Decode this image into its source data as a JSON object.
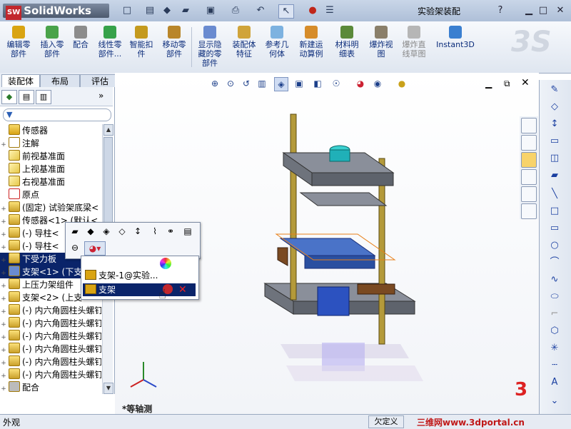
{
  "titlebar": {
    "app_name": "SolidWorks",
    "logo_badge": "SW",
    "window_title": "实验架装配",
    "help": "?",
    "quick_access": [
      "new-icon",
      "properties-icon",
      "rebuild-icon",
      "open-icon",
      "save-icon",
      "print-icon",
      "undo-icon",
      "select-icon",
      "traffic-light-icon",
      "options-icon"
    ]
  },
  "commands": [
    {
      "label": "编辑零\n部件"
    },
    {
      "label": "插入零\n部件"
    },
    {
      "label": "配合"
    },
    {
      "label": "线性零\n部件..."
    },
    {
      "label": "智能扣\n件"
    },
    {
      "label": "移动零\n部件"
    },
    {
      "label": "显示隐\n藏的零\n部件"
    },
    {
      "label": "装配体\n特征"
    },
    {
      "label": "参考几\n何体"
    },
    {
      "label": "新建运\n动算例"
    },
    {
      "label": "材料明\n细表"
    },
    {
      "label": "爆炸视\n图"
    },
    {
      "label": "爆炸直\n线草图"
    },
    {
      "label": "Instant3D"
    }
  ],
  "tabs": [
    {
      "label": "装配体"
    },
    {
      "label": "布局"
    },
    {
      "label": "评估"
    }
  ],
  "tree": [
    {
      "label": "传感器",
      "exp": ""
    },
    {
      "label": "注解",
      "exp": "+"
    },
    {
      "label": "前视基准面",
      "exp": ""
    },
    {
      "label": "上视基准面",
      "exp": ""
    },
    {
      "label": "右视基准面",
      "exp": ""
    },
    {
      "label": "原点",
      "exp": ""
    },
    {
      "label": "(固定) 试验架底梁<",
      "exp": "+"
    },
    {
      "label": "传感器<1> (默认<",
      "exp": "+"
    },
    {
      "label": "(-) 导柱<",
      "exp": "+"
    },
    {
      "label": "(-) 导柱<",
      "exp": "+"
    },
    {
      "label": "下受力板",
      "exp": "+"
    },
    {
      "label": "支架<1> (下支",
      "exp": "+"
    },
    {
      "label": "上压力架组件",
      "exp": "+"
    },
    {
      "label": "支架<2> (上支",
      "exp": "+"
    },
    {
      "label": "(-) 内六角圆柱头螺钉",
      "exp": "+"
    },
    {
      "label": "(-) 内六角圆柱头螺钉",
      "exp": "+"
    },
    {
      "label": "(-) 内六角圆柱头螺钉",
      "exp": "+"
    },
    {
      "label": "(-) 内六角圆柱头螺钉",
      "exp": "+"
    },
    {
      "label": "(-) 内六角圆柱头螺钉",
      "exp": "+"
    },
    {
      "label": "(-) 内六角圆柱头螺钉",
      "exp": "+"
    },
    {
      "label": "配合",
      "exp": "+"
    }
  ],
  "context_menu": {
    "items": [
      {
        "label": "支架-1@实验..."
      },
      {
        "label": "支架"
      }
    ]
  },
  "graphics": {
    "view_label": "*等轴测"
  },
  "status": {
    "left": "外观",
    "definition": "欠定义",
    "watermark": "三维网www.3dportal.cn"
  }
}
